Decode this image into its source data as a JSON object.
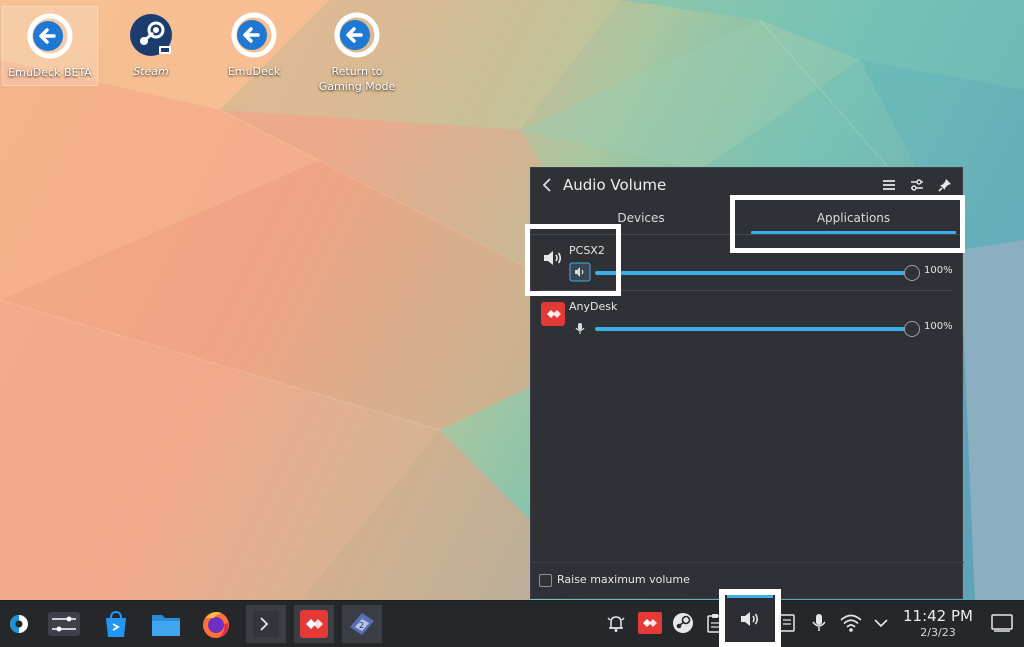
{
  "desktop": {
    "icons": [
      {
        "label": "EmuDeck BETA",
        "icon": "emudeck-arrow-icon"
      },
      {
        "label": "Steam",
        "icon": "steam-icon"
      },
      {
        "label": "EmuDeck",
        "icon": "emudeck-arrow-icon"
      },
      {
        "label": "Return to\nGaming Mode",
        "icon": "return-arrow-icon"
      }
    ]
  },
  "audio_panel": {
    "title": "Audio Volume",
    "tabs": [
      {
        "label": "Devices",
        "selected": false
      },
      {
        "label": "Applications",
        "selected": true
      }
    ],
    "applications": [
      {
        "name": "PCSX2",
        "volume": 100,
        "volume_label": "100%",
        "icon": "speaker-icon"
      },
      {
        "name": "AnyDesk",
        "volume": 100,
        "volume_label": "100%",
        "icon": "anydesk-icon"
      }
    ],
    "footer": {
      "raise_max_label": "Raise maximum volume",
      "raise_max_checked": false
    }
  },
  "taskbar": {
    "apps": [
      "app-launcher",
      "system-settings",
      "discover-store",
      "file-manager",
      "firefox",
      "konsole",
      "anydesk",
      "emulator"
    ],
    "tray": [
      "notifications",
      "anydesk",
      "steam",
      "clipboard",
      "volume",
      "storage",
      "microphone",
      "wifi",
      "expand"
    ],
    "clock": {
      "time": "11:42 PM",
      "date": "2/3/23"
    }
  },
  "colors": {
    "accent": "#3daee9",
    "panel_bg": "#2f3136",
    "taskbar_bg": "#25272b",
    "anydesk_red": "#e53935",
    "steam_blue": "#1b3d6e"
  }
}
